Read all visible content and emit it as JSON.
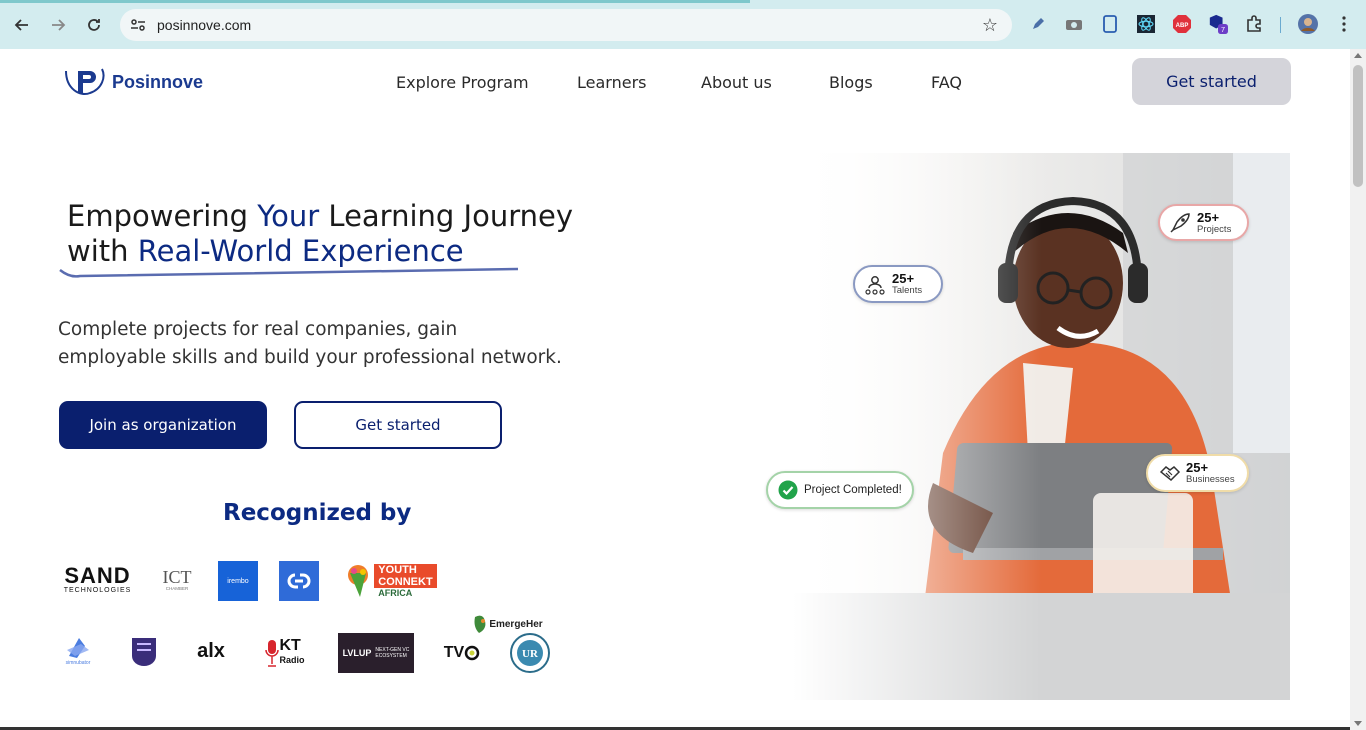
{
  "browser": {
    "url": "posinnove.com",
    "extension_badge": "7",
    "icons": [
      "back-arrow-icon",
      "forward-arrow-icon",
      "reload-icon",
      "site-settings-icon",
      "bookmark-star-icon",
      "pen-icon",
      "camera-icon",
      "tablet-icon",
      "react-devtools-icon",
      "adblock-plus-icon",
      "extension-puzzle-icon",
      "profile-avatar-icon",
      "more-menu-icon"
    ]
  },
  "header": {
    "logo_text": "Posinnove",
    "nav": [
      "Explore Program",
      "Learners",
      "About us",
      "Blogs",
      "FAQ"
    ],
    "cta": "Get started"
  },
  "hero": {
    "title_part1": "Empowering ",
    "title_accent1": "Your",
    "title_part2": " Learning Journey",
    "title_part3": "with ",
    "title_accent2": "Real-World Experience",
    "subtitle": "Complete projects for real companies, gain employable skills and build your professional network.",
    "btn_org": "Join as organization",
    "btn_start": "Get started",
    "recognized": "Recognized by"
  },
  "partners": {
    "sand": "SAND",
    "sand_sub": "TECHNOLOGIES",
    "ict": "ICT",
    "ict_sub": "CHAMBER",
    "irembo": "irembo",
    "youth": "YOUTH",
    "connekt": "CONNEKT",
    "africa": "AFRICA",
    "emergeher": "EmergeHer",
    "incubator": "simnubator",
    "alx": "alx",
    "kt": "KT",
    "kt_sub": "Radio",
    "lvlup": "LVLUP",
    "lvlup_sub": "NEXT-GEN VC ECOSYSTEM",
    "tv": "TV"
  },
  "stats": {
    "projects_num": "25+",
    "projects_lbl": "Projects",
    "talents_num": "25+",
    "talents_lbl": "Talents",
    "businesses_num": "25+",
    "businesses_lbl": "Businesses",
    "completed": "Project Completed!"
  },
  "colors": {
    "brand": "#0a1f6e",
    "accent": "#0c2a82",
    "chrome": "#d3ecef"
  }
}
